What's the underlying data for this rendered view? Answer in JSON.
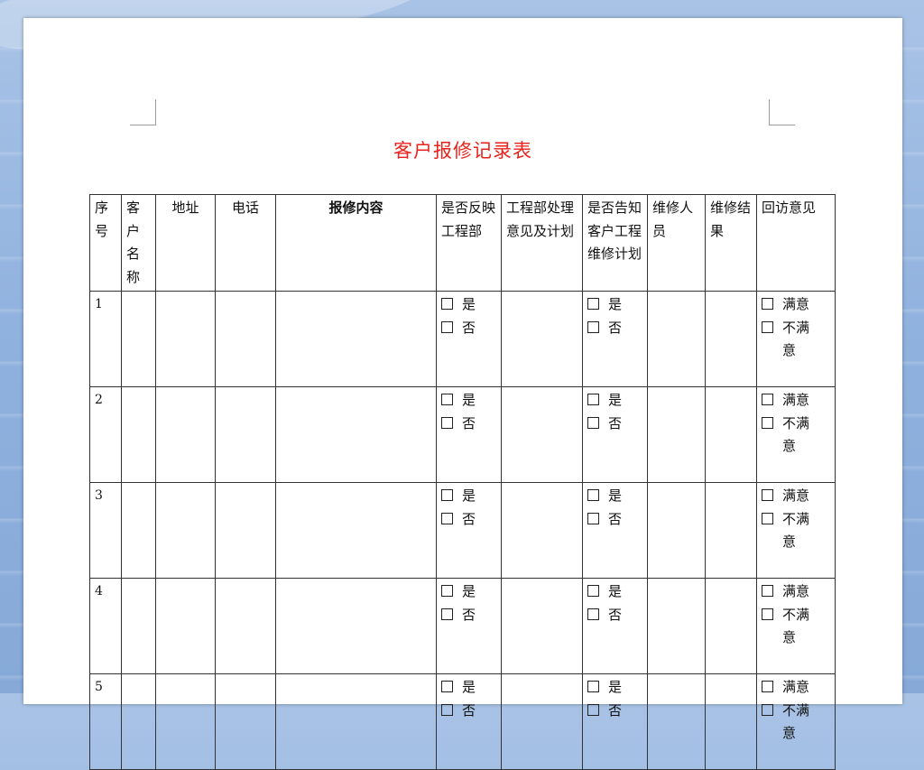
{
  "document": {
    "title": "客户报修记录表"
  },
  "table": {
    "headers": [
      "序号",
      "客户名称",
      "地址",
      "电话",
      "报修内容",
      "是否反映工程部",
      "工程部处理意见及计划",
      "是否告知客户工程维修计划",
      "维修人员",
      "维修结果",
      "回访意见"
    ],
    "yes_no_options": [
      "是",
      "否"
    ],
    "satisfaction_options": [
      "满意",
      "不满意"
    ],
    "rows": [
      {
        "num": "1"
      },
      {
        "num": "2"
      },
      {
        "num": "3"
      },
      {
        "num": "4"
      },
      {
        "num": "5"
      }
    ]
  },
  "icons": {
    "checkbox": "checkbox-icon"
  }
}
